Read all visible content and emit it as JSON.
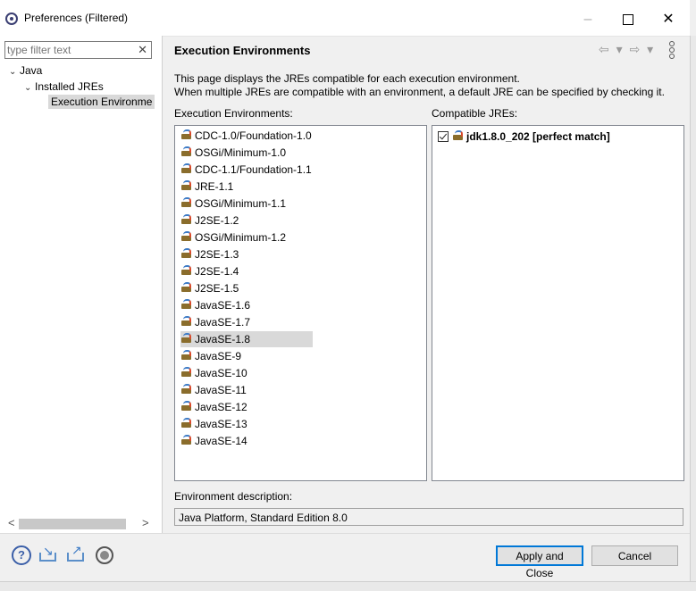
{
  "window": {
    "title": "Preferences (Filtered)",
    "controls": {
      "minimize": "–",
      "close": "✕"
    }
  },
  "sidebar": {
    "filter_placeholder": "type filter text",
    "filter_clear": "✕",
    "tree": [
      {
        "label": "Java",
        "expanded": true
      },
      {
        "label": "Installed JREs",
        "expanded": true
      },
      {
        "label": "Execution Environme",
        "selected": true
      }
    ],
    "scroll_left": "<",
    "scroll_right": ">"
  },
  "page": {
    "title": "Execution Environments",
    "description_line1": "This page displays the JREs compatible for each execution environment.",
    "description_line2": "When multiple JREs are compatible with an environment, a default JRE can be specified by checking it.",
    "nav_back": "⇦ ▾",
    "nav_forward": "⇨ ▾",
    "envs_label": "Execution Environments:",
    "compat_label": "Compatible JREs:",
    "environments": [
      "CDC-1.0/Foundation-1.0",
      "OSGi/Minimum-1.0",
      "CDC-1.1/Foundation-1.1",
      "JRE-1.1",
      "OSGi/Minimum-1.1",
      "J2SE-1.2",
      "OSGi/Minimum-1.2",
      "J2SE-1.3",
      "J2SE-1.4",
      "J2SE-1.5",
      "JavaSE-1.6",
      "JavaSE-1.7",
      "JavaSE-1.8",
      "JavaSE-9",
      "JavaSE-10",
      "JavaSE-11",
      "JavaSE-12",
      "JavaSE-13",
      "JavaSE-14"
    ],
    "selected_environment": "JavaSE-1.8",
    "compatible_jre": {
      "label": "jdk1.8.0_202 [perfect match]",
      "checked": true
    },
    "env_description_label": "Environment description:",
    "env_description_value": "Java Platform, Standard Edition 8.0"
  },
  "footer": {
    "help_glyph": "?",
    "apply_close_label": "Apply and Close",
    "cancel_label": "Cancel"
  },
  "colors": {
    "accent": "#0078d7",
    "selection": "#d9d9d9"
  }
}
